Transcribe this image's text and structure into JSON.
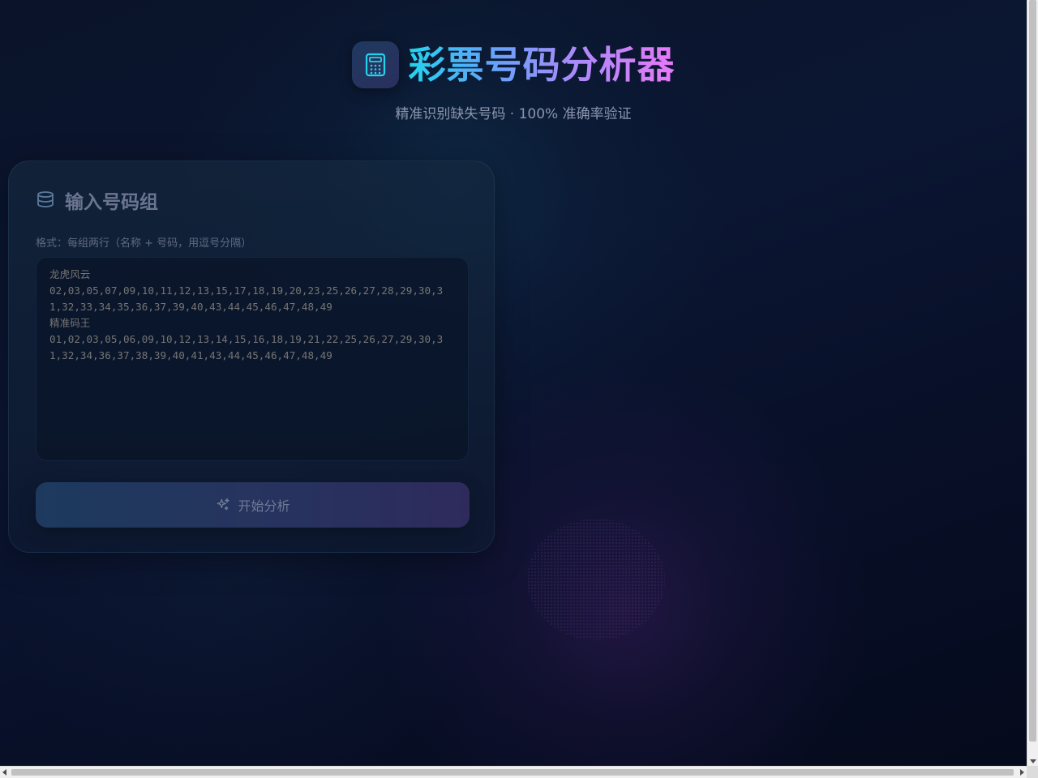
{
  "header": {
    "title": "彩票号码分析器",
    "subtitle": "精准识别缺失号码 · 100% 准确率验证",
    "logo_icon": "calculator-icon"
  },
  "input_card": {
    "title": "输入号码组",
    "title_icon": "database-icon",
    "hint": "格式：每组两行（名称 + 号码，用逗号分隔）",
    "placeholder": "龙虎风云\n02,03,05,07,09,10,11,12,13,15,17,18,19,20,23,25,26,27,28,29,30,31,32,33,34,35,36,37,39,40,43,44,45,46,47,48,49\n精准码王\n01,02,03,05,06,09,10,12,13,14,15,16,18,19,21,22,25,26,27,29,30,31,32,34,36,37,38,39,40,41,43,44,45,46,47,48,49",
    "value": "",
    "analyze_button": {
      "label": "开始分析",
      "icon": "sparkles-icon"
    }
  },
  "colors": {
    "accent_cyan": "#22d3ee",
    "accent_purple": "#a78bfa",
    "accent_pink": "#e879f9",
    "background": "#070d22"
  }
}
